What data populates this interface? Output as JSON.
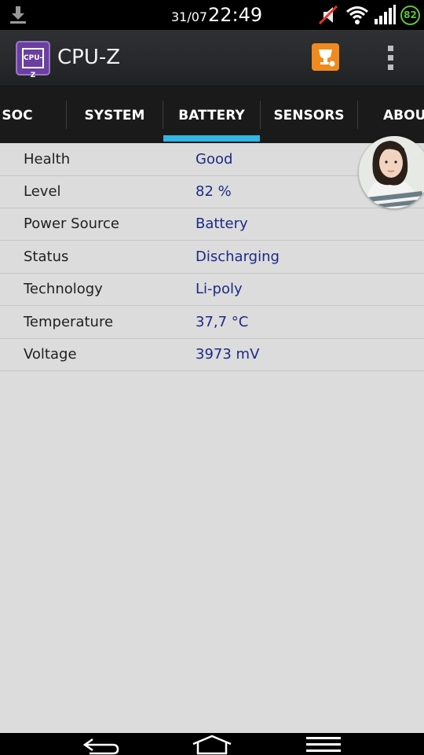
{
  "status_bar": {
    "date": "31/07",
    "time": "22:49",
    "battery_level": "82",
    "icons": [
      "download-icon",
      "mute-icon",
      "wifi-icon",
      "signal-icon",
      "battery-icon"
    ]
  },
  "app": {
    "logo_text": "CPU-Z",
    "title": "CPU-Z"
  },
  "tabs": [
    {
      "label": "SOC"
    },
    {
      "label": "SYSTEM"
    },
    {
      "label": "BATTERY",
      "active": true
    },
    {
      "label": "SENSORS"
    },
    {
      "label": "ABOUT"
    }
  ],
  "battery": [
    {
      "label": "Health",
      "value": "Good"
    },
    {
      "label": "Level",
      "value": "82 %"
    },
    {
      "label": "Power Source",
      "value": "Battery"
    },
    {
      "label": "Status",
      "value": "Discharging"
    },
    {
      "label": "Technology",
      "value": "Li-poly"
    },
    {
      "label": "Temperature",
      "value": "37,7 °C"
    },
    {
      "label": "Voltage",
      "value": "3973 mV"
    }
  ],
  "colors": {
    "accent": "#33b5e5",
    "value_text": "#1c2a86",
    "trophy": "#f08a1f",
    "battery_ring": "#5cc43a"
  }
}
